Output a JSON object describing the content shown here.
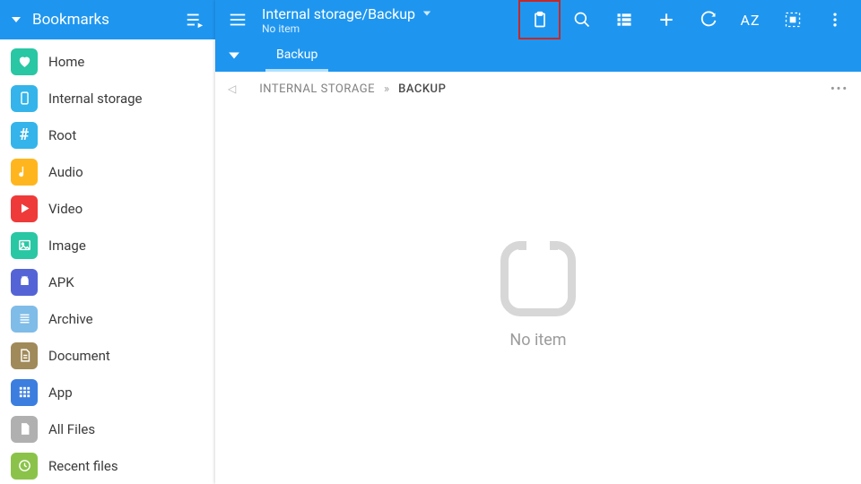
{
  "sidebar": {
    "title": "Bookmarks",
    "items": [
      {
        "label": "Home",
        "icon": "heart",
        "color": "#29c7a3"
      },
      {
        "label": "Internal storage",
        "icon": "phone",
        "color": "#34b4ea"
      },
      {
        "label": "Root",
        "icon": "hash",
        "color": "#34b4ea"
      },
      {
        "label": "Audio",
        "icon": "music",
        "color": "#ffb61e"
      },
      {
        "label": "Video",
        "icon": "play",
        "color": "#ef3a3a"
      },
      {
        "label": "Image",
        "icon": "image",
        "color": "#29c7a3"
      },
      {
        "label": "APK",
        "icon": "android",
        "color": "#5464d6"
      },
      {
        "label": "Archive",
        "icon": "archive",
        "color": "#7fbce8"
      },
      {
        "label": "Document",
        "icon": "document",
        "color": "#a08a5a"
      },
      {
        "label": "App",
        "icon": "apps",
        "color": "#3b7ee0"
      },
      {
        "label": "All Files",
        "icon": "file",
        "color": "#b0b0b0"
      },
      {
        "label": "Recent files",
        "icon": "clock",
        "color": "#8bc34a"
      }
    ]
  },
  "header": {
    "path": "Internal storage/Backup",
    "subtitle": "No item",
    "toolbar": {
      "clipboard": "clipboard",
      "search": "search",
      "view": "list-view",
      "add": "add",
      "refresh": "refresh",
      "sort": "AZ",
      "select": "select-all",
      "more": "more"
    }
  },
  "tabs": {
    "active": "Backup"
  },
  "breadcrumb": {
    "root": "INTERNAL STORAGE",
    "sep": "»",
    "current": "BACKUP"
  },
  "empty": {
    "text": "No item"
  }
}
